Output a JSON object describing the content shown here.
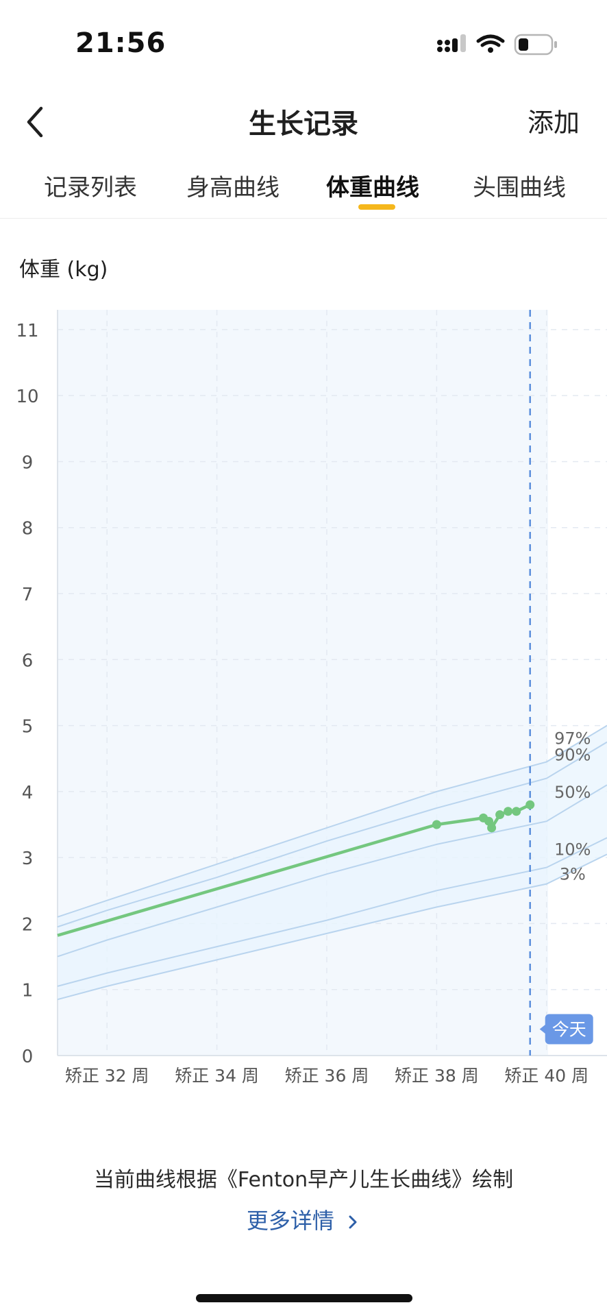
{
  "status_bar": {
    "time": "21:56"
  },
  "nav": {
    "title": "生长记录",
    "add_label": "添加",
    "back_icon": "chevron-left-icon"
  },
  "tabs": [
    {
      "label": "记录列表",
      "active": false
    },
    {
      "label": "身高曲线",
      "active": false
    },
    {
      "label": "体重曲线",
      "active": true
    },
    {
      "label": "头围曲线",
      "active": false
    }
  ],
  "colors": {
    "accent": "#f5b71c",
    "series": "#74c77f",
    "percentile_line": "#b9d4ee",
    "band": "#e8f4fd",
    "today_line": "#5b8fdc",
    "today_badge": "#6a98e6",
    "link": "#2d5fa8"
  },
  "chart_data": {
    "type": "line",
    "title": "体重 (kg)",
    "ylabel": "体重 (kg)",
    "ylim": [
      0,
      11.3
    ],
    "y_ticks": [
      0,
      1,
      2,
      3,
      4,
      5,
      6,
      7,
      8,
      9,
      10,
      11
    ],
    "xlim": [
      31.1,
      41.1
    ],
    "x_ticks": [
      {
        "value": 32,
        "label": "矫正 32 周"
      },
      {
        "value": 34,
        "label": "矫正 34 周"
      },
      {
        "value": 36,
        "label": "矫正 36 周"
      },
      {
        "value": 38,
        "label": "矫正 38 周"
      },
      {
        "value": 40,
        "label": "矫正 40 周"
      }
    ],
    "grid": true,
    "percentiles": [
      {
        "name": "97%",
        "x": [
          31.1,
          32,
          34,
          36,
          38,
          40,
          41.1
        ],
        "values": [
          2.1,
          2.35,
          2.9,
          3.45,
          4.0,
          4.45,
          5.0
        ]
      },
      {
        "name": "90%",
        "x": [
          31.1,
          32,
          34,
          36,
          38,
          40,
          41.1
        ],
        "values": [
          1.95,
          2.2,
          2.7,
          3.25,
          3.75,
          4.2,
          4.75
        ]
      },
      {
        "name": "50%",
        "x": [
          31.1,
          32,
          34,
          36,
          38,
          40,
          41.1
        ],
        "values": [
          1.5,
          1.75,
          2.25,
          2.75,
          3.2,
          3.55,
          4.1
        ]
      },
      {
        "name": "10%",
        "x": [
          31.1,
          32,
          34,
          36,
          38,
          40,
          41.1
        ],
        "values": [
          1.05,
          1.25,
          1.65,
          2.05,
          2.5,
          2.85,
          3.3
        ]
      },
      {
        "name": "3%",
        "x": [
          31.1,
          32,
          34,
          36,
          38,
          40,
          41.1
        ],
        "values": [
          0.85,
          1.05,
          1.45,
          1.85,
          2.25,
          2.6,
          3.05
        ]
      }
    ],
    "series": [
      {
        "x": [
          31.1,
          38.0,
          38.85,
          38.95,
          39.0,
          39.15,
          39.3,
          39.45,
          39.7
        ],
        "values": [
          1.82,
          3.5,
          3.6,
          3.55,
          3.45,
          3.65,
          3.7,
          3.7,
          3.8
        ]
      }
    ],
    "today": {
      "x": 39.7,
      "label": "今天"
    }
  },
  "footer": {
    "note": "当前曲线根据《Fenton早产儿生长曲线》绘制",
    "more_label": "更多详情"
  }
}
